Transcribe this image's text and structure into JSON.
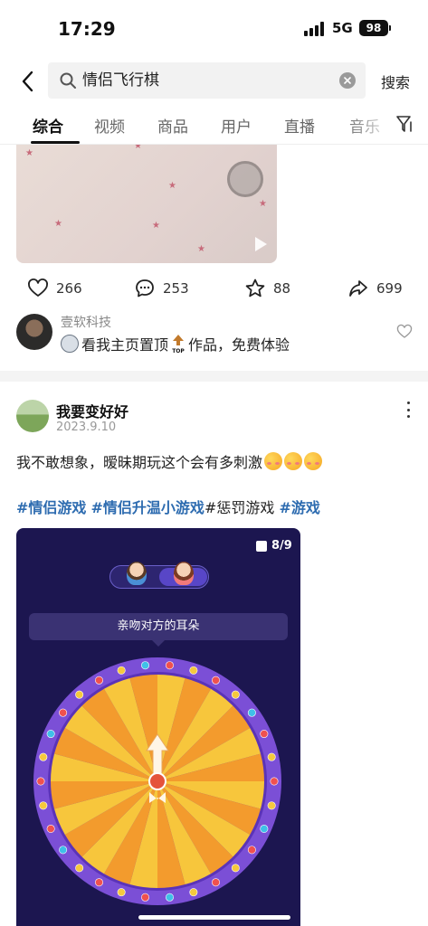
{
  "status": {
    "time": "17:29",
    "network": "5G",
    "battery": "98"
  },
  "search": {
    "query": "情侣飞行棋",
    "submit_label": "搜索"
  },
  "tabs": [
    {
      "label": "综合",
      "active": true
    },
    {
      "label": "视频"
    },
    {
      "label": "商品"
    },
    {
      "label": "用户"
    },
    {
      "label": "直播"
    },
    {
      "label": "音乐"
    }
  ],
  "post1": {
    "actions": {
      "likes": "266",
      "comments": "253",
      "favorites": "88",
      "shares": "699"
    },
    "author": {
      "name": "壹软科技",
      "desc_part1": "看我主页置顶",
      "desc_part2": "作品，免费体验"
    }
  },
  "post2": {
    "author": "我要变好好",
    "date": "2023.9.10",
    "text": "我不敢想象，暧昧期玩这个会有多刺激",
    "tags": [
      {
        "text": "#情侣游戏",
        "style": "tag"
      },
      {
        "text": " ",
        "style": "plain"
      },
      {
        "text": "#情侣升温小游戏",
        "style": "tag"
      },
      {
        "text": "#惩罚游戏",
        "style": "plain"
      },
      {
        "text": " ",
        "style": "plain"
      },
      {
        "text": "#游戏",
        "style": "tag"
      }
    ],
    "image": {
      "counter": "8/9",
      "prompt": "亲吻对方的耳朵"
    }
  },
  "colors": {
    "tag_blue": "#2e6cb0",
    "game_bg": "#1c1650",
    "wheel_rim": "#7b4fd6",
    "wheel_yellow": "#f7c63c",
    "wheel_orange": "#f39b2d"
  }
}
